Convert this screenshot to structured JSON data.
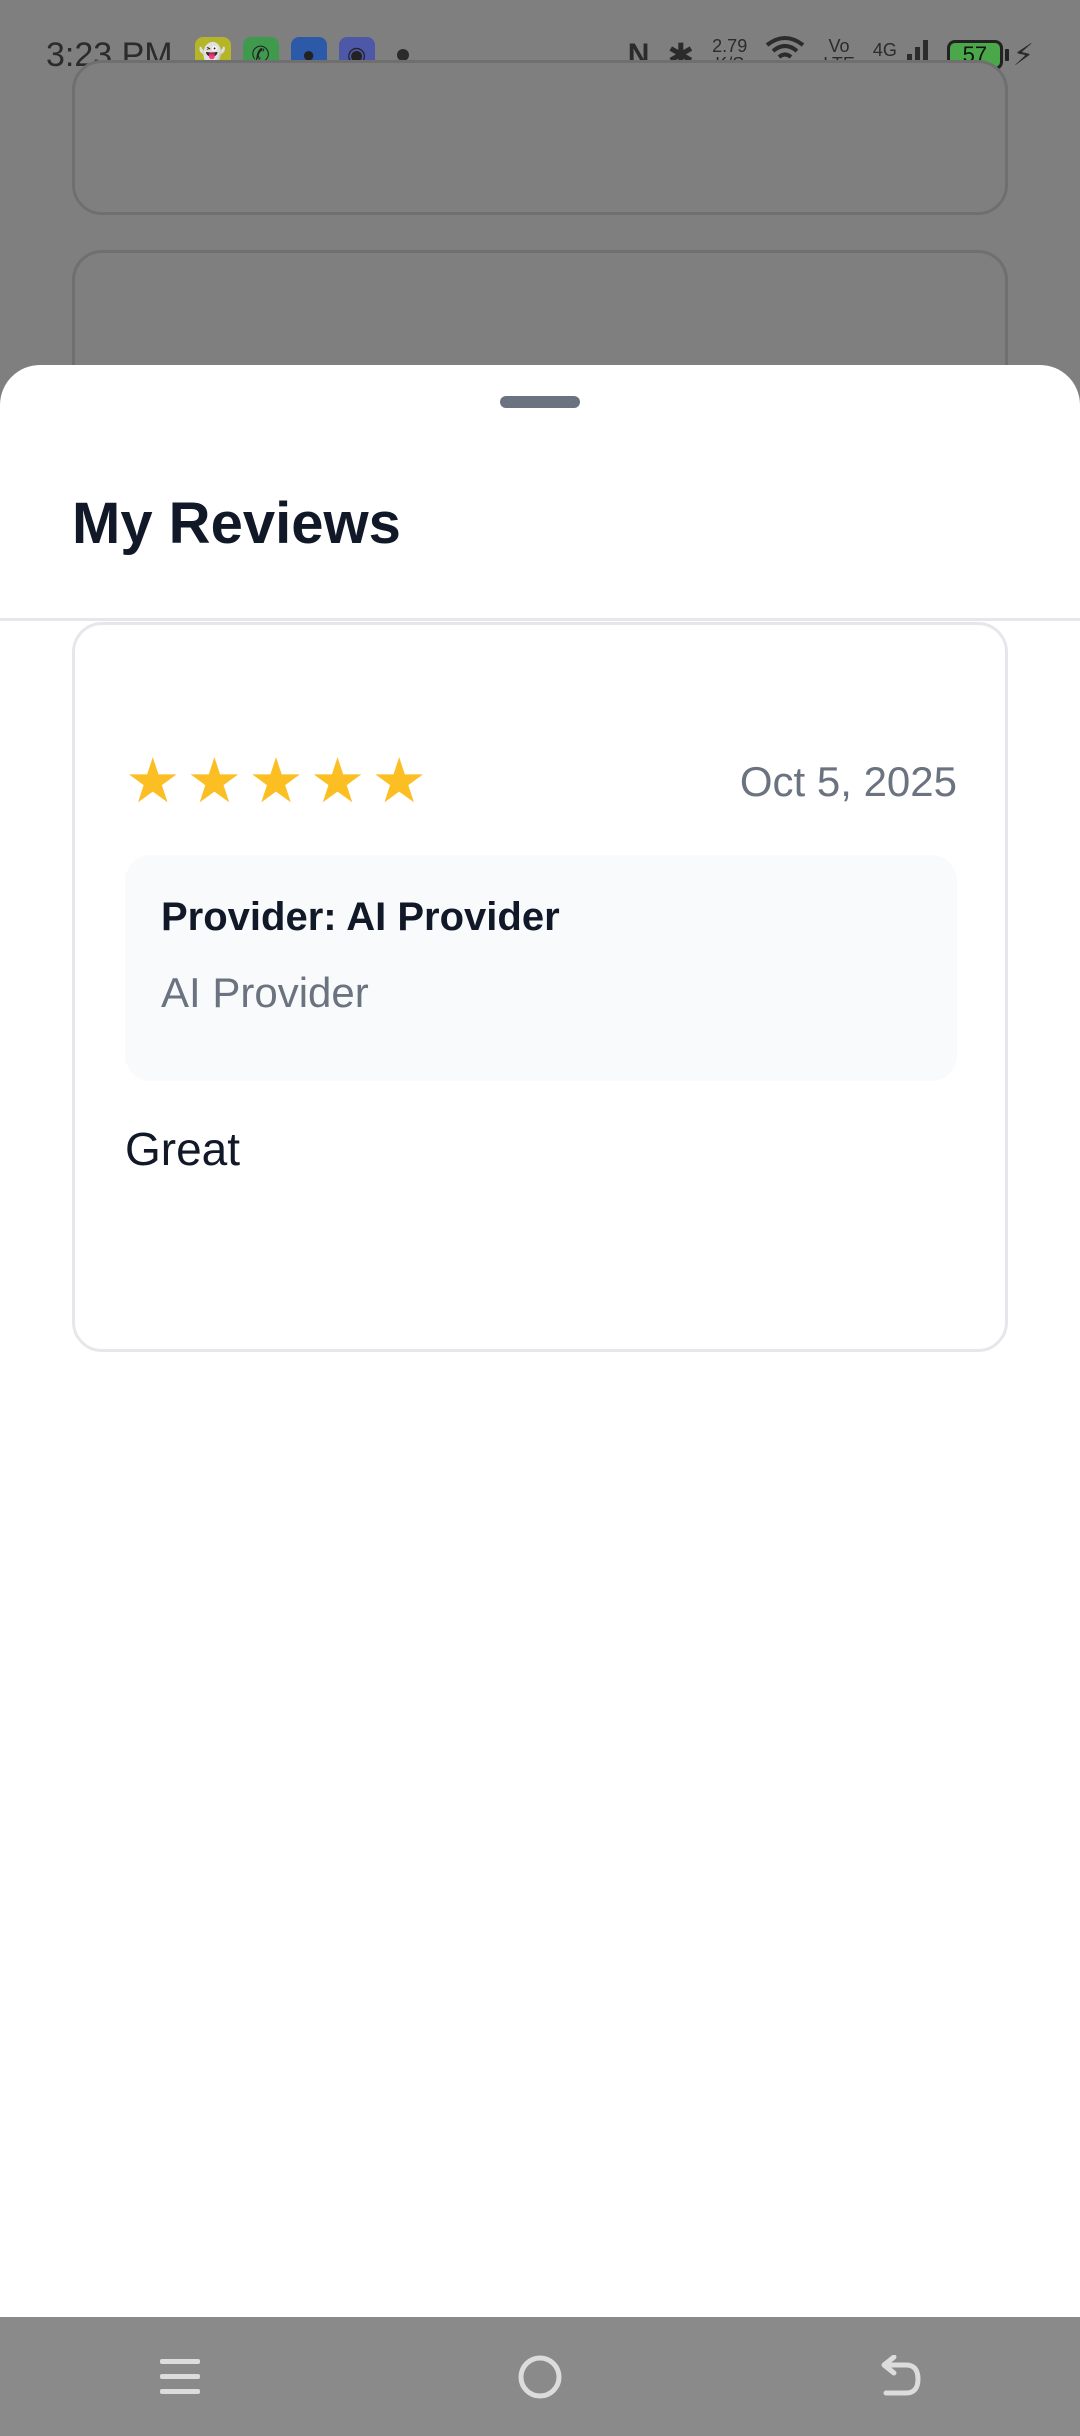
{
  "status_bar": {
    "time": "3:23 PM",
    "app_icons": [
      "snapchat-icon",
      "whatsapp-icon",
      "messages-icon",
      "discord-icon"
    ],
    "net_speed_value": "2.79",
    "net_speed_unit": "K/S",
    "volte_top": "Vo",
    "volte_bottom": "LTE",
    "network": "4G",
    "battery": "57"
  },
  "sheet": {
    "title": "My Reviews"
  },
  "reviews": [
    {
      "rating": 5,
      "date": "Oct 5, 2025",
      "provider_label": "Provider: AI Provider",
      "provider_name": "AI Provider",
      "text": "Great"
    }
  ],
  "colors": {
    "scrim": "#7f7f7f",
    "sheet_bg": "#ffffff",
    "title": "#111827",
    "muted": "#6b7280",
    "star": "#fbbf24"
  }
}
